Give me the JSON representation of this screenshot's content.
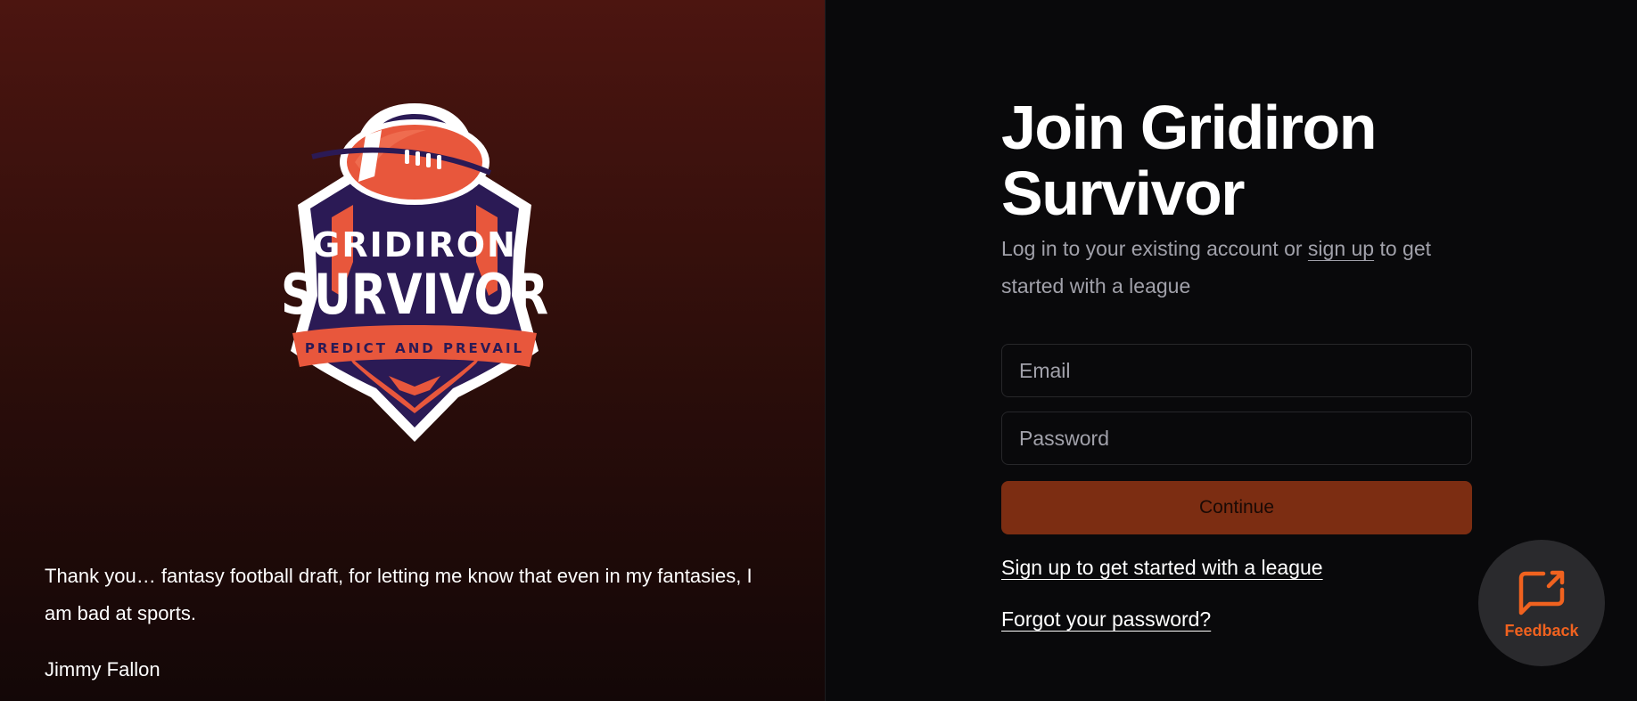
{
  "logo": {
    "line1": "GRIDIRON",
    "line2": "SURVIVOR",
    "tagline": "PREDICT AND PREVAIL"
  },
  "quote": {
    "text": "Thank you… fantasy football draft, for letting me know that even in my fantasies, I am bad at sports.",
    "author": "Jimmy Fallon"
  },
  "form": {
    "title": "Join Gridiron Survivor",
    "subtitle_before": "Log in to your existing account or ",
    "subtitle_link": "sign up",
    "subtitle_after": " to get started with a league",
    "email_placeholder": "Email",
    "password_placeholder": "Password",
    "continue_label": "Continue",
    "signup_link": "Sign up to get started with a league",
    "forgot_link": "Forgot your password?"
  },
  "feedback": {
    "label": "Feedback",
    "icon": "message-arrow-icon"
  },
  "colors": {
    "accent": "#f0621f",
    "button": "#7c2d12",
    "panel_top": "#4c1510",
    "background": "#09090b"
  }
}
